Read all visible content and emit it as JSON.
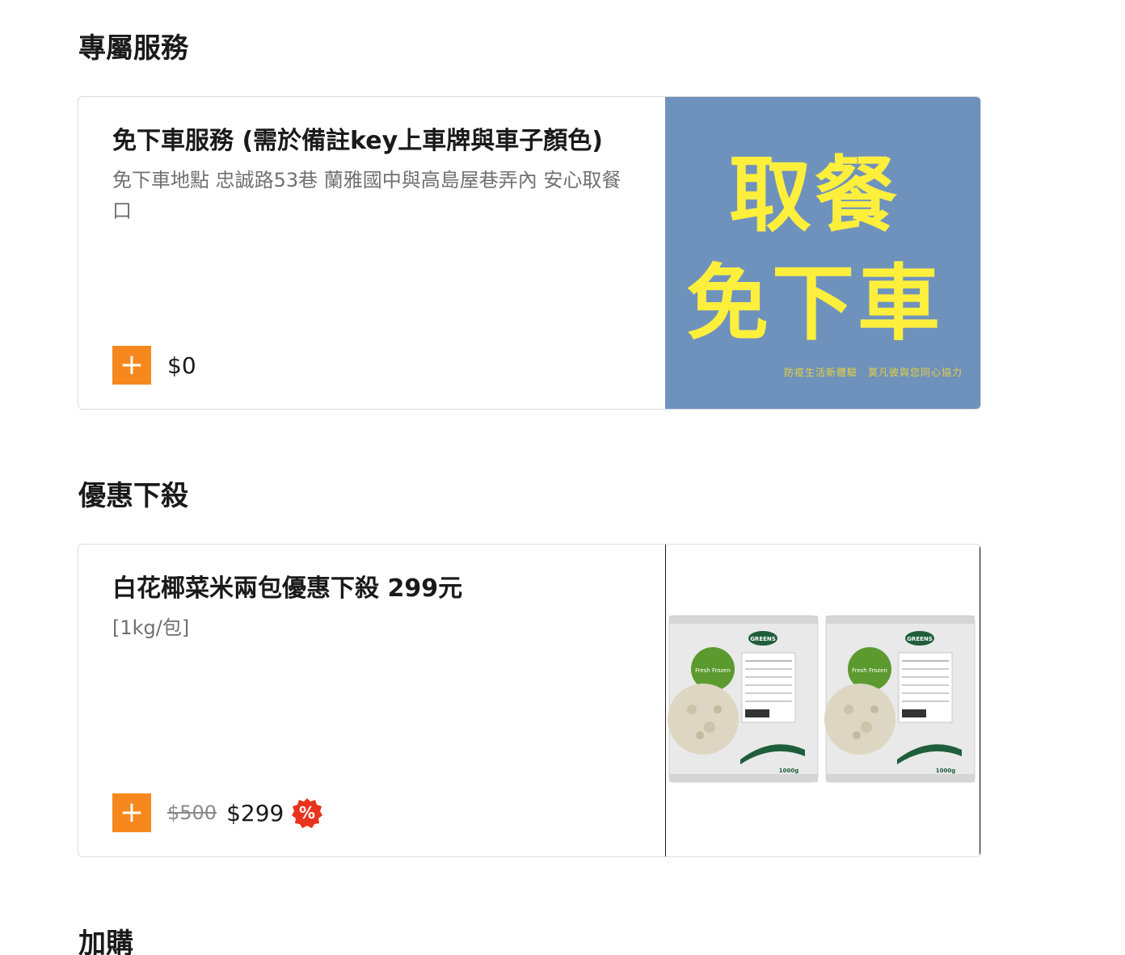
{
  "sections": {
    "exclusive": {
      "title": "專屬服務",
      "item": {
        "name": "免下車服務 (需於備註key上車牌與車子顏色)",
        "description": "免下車地點 忠誠路53巷 蘭雅國中與高島屋巷弄內 安心取餐口",
        "price": "$0",
        "add_label": "+",
        "image": {
          "line1": "取餐",
          "line2": "免下車",
          "caption": "防疫生活新體驗　莫凡彼與您同心協力",
          "background": "#6f92bd",
          "text_color": "#ffef3d"
        }
      }
    },
    "deals": {
      "title": "優惠下殺",
      "item": {
        "name": "白花椰菜米兩包優惠下殺 299元",
        "description": "[1kg/包]",
        "original_price": "$500",
        "sale_price": "$299",
        "add_label": "+",
        "discount_badge_label": "%",
        "image": {
          "brand": "GREENS",
          "tag": "Fresh Frozen",
          "weight": "1000g"
        }
      }
    },
    "addons": {
      "title": "加購"
    }
  },
  "colors": {
    "accent": "#f7881e",
    "badge": "#e8331d",
    "pack_green": "#5c9a2f"
  }
}
